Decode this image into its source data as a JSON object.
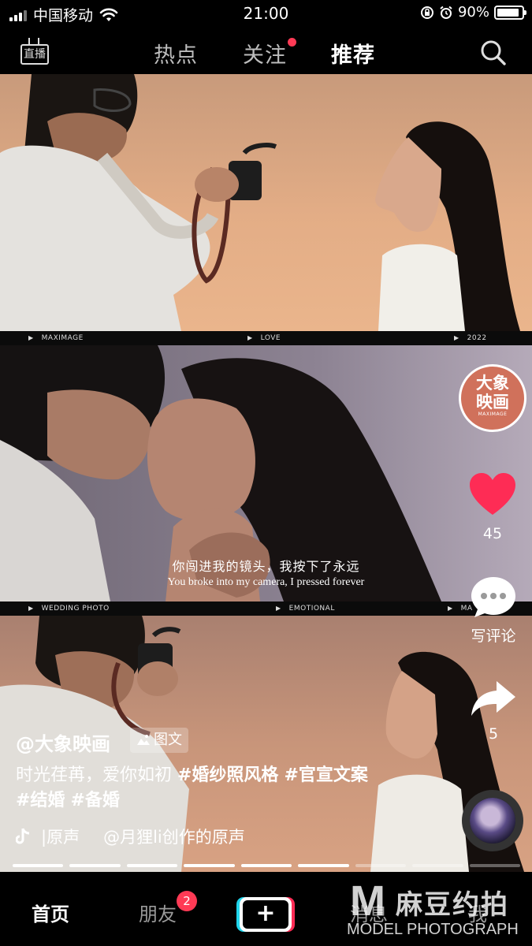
{
  "status_bar": {
    "carrier": "中国移动",
    "time": "21:00",
    "battery_percent": "90%",
    "battery_level": 0.9,
    "icons": [
      "signal-icon",
      "wifi-icon",
      "lock-rotation-icon",
      "alarm-icon",
      "battery-icon"
    ]
  },
  "top_nav": {
    "live_label": "直播",
    "tabs": [
      {
        "label": "热点",
        "active": false
      },
      {
        "label": "关注",
        "active": false,
        "dot": true
      },
      {
        "label": "推荐",
        "active": true
      }
    ]
  },
  "photo_strips": [
    {
      "left": "MAXIMAGE",
      "center": "LOVE",
      "right": "2022"
    },
    {
      "left": "WEDDING PHOTO",
      "center": "EMOTIONAL",
      "right": "MA"
    }
  ],
  "subtitles": {
    "cn": "你闯进我的镜头，我按下了永远",
    "en": "You broke into my camera, I pressed forever"
  },
  "rail": {
    "avatar_line1": "大象",
    "avatar_line2": "映画",
    "avatar_sub": "MAXIMAGE",
    "like_count": "45",
    "comment_label": "写评论",
    "share_count": "5"
  },
  "post": {
    "author": "@大象映画",
    "type_badge": "图文",
    "caption_text": "时光荏苒，爱你如初 ",
    "hashtags": [
      "#婚纱照风格",
      "#官宣文案",
      "#结婚",
      "#备婚"
    ],
    "music_label": "原声",
    "music_credit": "@月狸li创作的原声"
  },
  "progress": {
    "total": 9,
    "done": 6
  },
  "bottom_nav": {
    "home": "首页",
    "friends": "朋友",
    "friends_badge": "2",
    "plus": "+",
    "messages": "消息",
    "me": "我"
  },
  "watermark": {
    "mark": "M",
    "cn": "麻豆约拍",
    "en": "MODEL PHOTOGRAPH"
  },
  "colors": {
    "accent_red": "#fe2c55",
    "badge_red": "#ff3a55",
    "brand_logo": "#d0715b",
    "cyan": "#20d5ec"
  }
}
